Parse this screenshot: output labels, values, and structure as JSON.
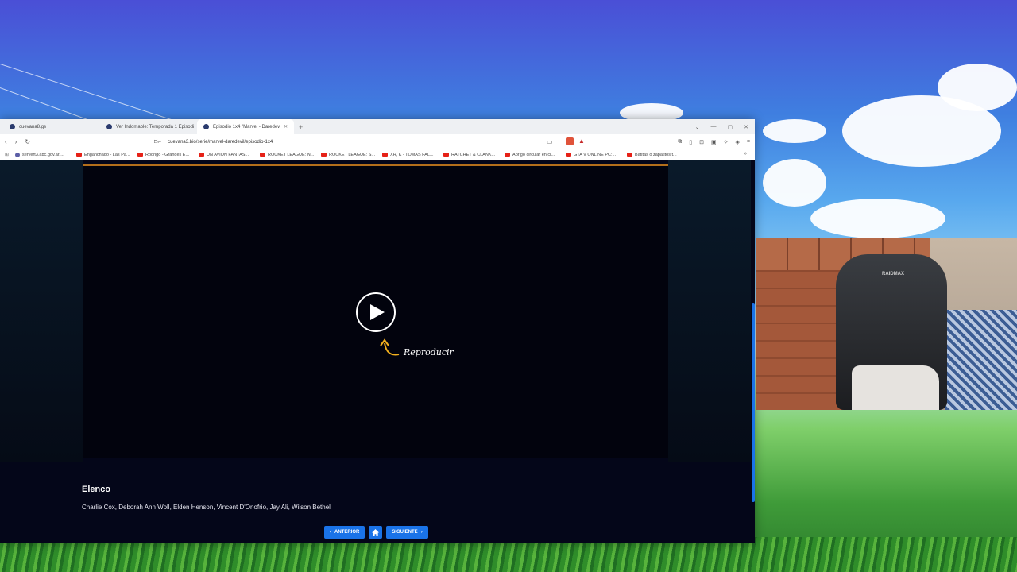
{
  "browser": {
    "tabs": [
      {
        "title": "cuevana8.gs",
        "active": false
      },
      {
        "title": "Ver Indomable: Temporada 1 Episodi",
        "active": false
      },
      {
        "title": "Episodio 1x4 \"Marvel - Daredev",
        "active": true
      }
    ],
    "url": "cuevana3.bio/serie/marvel-daredevil/episodio-1x4",
    "bookmarks": [
      {
        "label": "servert3.abc.gov.ar/...",
        "icon": "gov"
      },
      {
        "label": "Enganchado - Las Pa...",
        "icon": "youtube"
      },
      {
        "label": "Rodrigo - Grandes E...",
        "icon": "youtube"
      },
      {
        "label": "UN AVION FANTAS...",
        "icon": "youtube"
      },
      {
        "label": "ROCKET LEAGUE: N...",
        "icon": "youtube"
      },
      {
        "label": "ROCKET LEAGUE: S...",
        "icon": "youtube"
      },
      {
        "label": "XR, K - TOMAS FAL...",
        "icon": "youtube"
      },
      {
        "label": "RATCHET & CLANK...",
        "icon": "youtube"
      },
      {
        "label": "Abrigo circular en cr...",
        "icon": "youtube"
      },
      {
        "label": "GTA V ONLINE PC:...",
        "icon": "youtube"
      },
      {
        "label": "Batitas o zapatitos t...",
        "icon": "youtube"
      }
    ]
  },
  "player": {
    "play_hint": "Reproducir"
  },
  "cast": {
    "title": "Elenco",
    "names": "Charlie Cox, Deborah Ann Woll, Elden Henson, Vincent D'Onofrio, Jay Ali, Wilson Bethel"
  },
  "navigation": {
    "prev_label": "ANTERIOR",
    "next_label": "SIGUIENTE"
  },
  "webcam": {
    "chair_brand": "RAIDMAX"
  },
  "colors": {
    "accent": "#1a73e8",
    "page_bg": "#040619"
  }
}
